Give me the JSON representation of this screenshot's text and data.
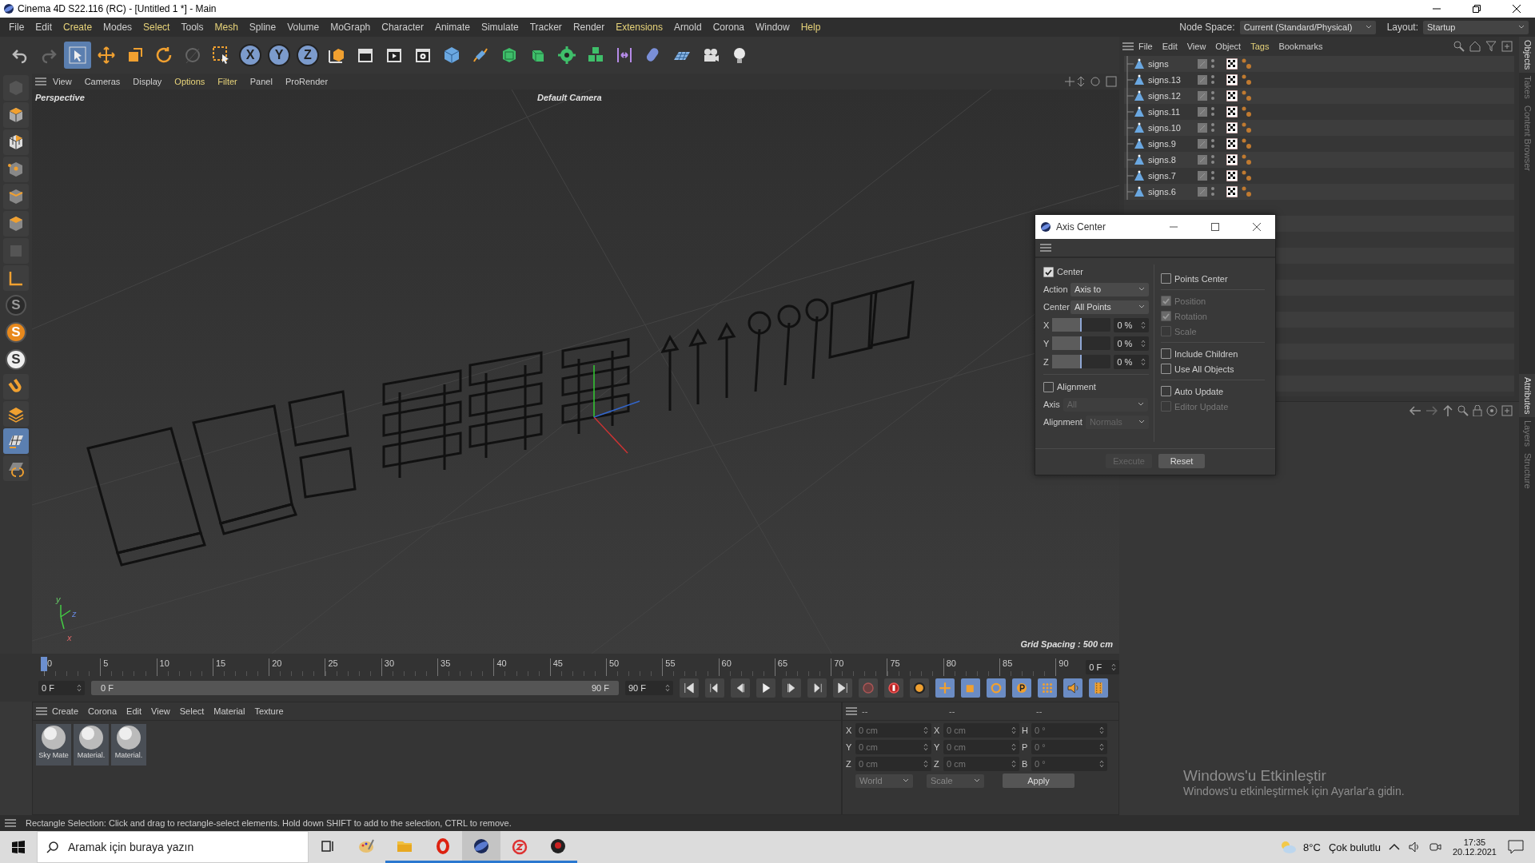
{
  "window": {
    "title": "Cinema 4D S22.116 (RC) - [Untitled 1 *] - Main"
  },
  "menu": [
    {
      "label": "File",
      "highlighted": false
    },
    {
      "label": "Edit",
      "highlighted": false
    },
    {
      "label": "Create",
      "highlighted": true
    },
    {
      "label": "Modes",
      "highlighted": false
    },
    {
      "label": "Select",
      "highlighted": true
    },
    {
      "label": "Tools",
      "highlighted": false
    },
    {
      "label": "Mesh",
      "highlighted": true
    },
    {
      "label": "Spline",
      "highlighted": false
    },
    {
      "label": "Volume",
      "highlighted": false
    },
    {
      "label": "MoGraph",
      "highlighted": false
    },
    {
      "label": "Character",
      "highlighted": false
    },
    {
      "label": "Animate",
      "highlighted": false
    },
    {
      "label": "Simulate",
      "highlighted": false
    },
    {
      "label": "Tracker",
      "highlighted": false
    },
    {
      "label": "Render",
      "highlighted": false
    },
    {
      "label": "Extensions",
      "highlighted": true
    },
    {
      "label": "Arnold",
      "highlighted": false
    },
    {
      "label": "Corona",
      "highlighted": false
    },
    {
      "label": "Window",
      "highlighted": false
    },
    {
      "label": "Help",
      "highlighted": true
    }
  ],
  "node_space": {
    "label": "Node Space:",
    "value": "Current (Standard/Physical)"
  },
  "layout": {
    "label": "Layout:",
    "value": "Startup"
  },
  "toolbar": [
    {
      "kind": "undo",
      "selected": false
    },
    {
      "kind": "redo",
      "selected": false
    },
    {
      "kind": "live-select",
      "selected": true
    },
    {
      "kind": "move",
      "selected": false
    },
    {
      "kind": "scale",
      "selected": false
    },
    {
      "kind": "rotate",
      "selected": false
    },
    {
      "kind": "recent-tools",
      "selected": false
    },
    {
      "kind": "rectangle-select",
      "selected": false
    },
    {
      "kind": "axis",
      "label": "X",
      "selected": true
    },
    {
      "kind": "axis",
      "label": "Y",
      "selected": true
    },
    {
      "kind": "axis",
      "label": "Z",
      "selected": true
    },
    {
      "kind": "coordinate-system",
      "selected": false
    },
    {
      "kind": "render-view",
      "selected": false
    },
    {
      "kind": "render",
      "selected": false
    },
    {
      "kind": "render-settings",
      "selected": false
    },
    {
      "kind": "cube",
      "selected": false
    },
    {
      "kind": "pen",
      "selected": false
    },
    {
      "kind": "subdivision",
      "selected": false
    },
    {
      "kind": "extrude",
      "selected": false
    },
    {
      "kind": "cloner",
      "selected": false
    },
    {
      "kind": "cubes",
      "selected": false
    },
    {
      "kind": "deformer",
      "selected": false
    },
    {
      "kind": "field",
      "selected": false
    },
    {
      "kind": "floor",
      "selected": false
    },
    {
      "kind": "camera",
      "selected": false
    },
    {
      "kind": "light",
      "selected": false
    }
  ],
  "tools": [
    {
      "kind": "make-editable",
      "selected": false
    },
    {
      "kind": "model",
      "selected": false
    },
    {
      "kind": "texture",
      "selected": false
    },
    {
      "kind": "points",
      "selected": false
    },
    {
      "kind": "edges",
      "selected": false
    },
    {
      "kind": "polygons",
      "selected": false
    },
    {
      "kind": "uv",
      "selected": false
    },
    {
      "kind": "axis",
      "selected": false
    },
    {
      "kind": "letter",
      "label": "S",
      "color": "#2b2b2b",
      "selected": false
    },
    {
      "kind": "letter",
      "label": "S",
      "color": "#e8891d",
      "selected": false
    },
    {
      "kind": "letter",
      "label": "S",
      "color": "#eeeeee",
      "selected": false
    },
    {
      "kind": "magnet",
      "selected": false
    },
    {
      "kind": "layers",
      "selected": false
    },
    {
      "kind": "workplane",
      "selected": true
    },
    {
      "kind": "snap",
      "selected": false
    }
  ],
  "viewport": {
    "menu": [
      {
        "label": "View",
        "highlighted": false
      },
      {
        "label": "Cameras",
        "highlighted": false
      },
      {
        "label": "Display",
        "highlighted": false
      },
      {
        "label": "Options",
        "highlighted": true
      },
      {
        "label": "Filter",
        "highlighted": true
      },
      {
        "label": "Panel",
        "highlighted": false
      },
      {
        "label": "ProRender",
        "highlighted": false
      }
    ],
    "view_name": "Perspective",
    "camera": "Default Camera",
    "grid_spacing": "Grid Spacing : 500 cm",
    "axis_labels": [
      "y",
      "z",
      "x"
    ]
  },
  "timeline": {
    "ticks": [
      "0",
      "5",
      "10",
      "15",
      "20",
      "25",
      "30",
      "35",
      "40",
      "45",
      "50",
      "55",
      "60",
      "65",
      "70",
      "75",
      "80",
      "85",
      "90"
    ],
    "current_frame": "0 F",
    "start": "0 F",
    "range": {
      "start": "0 F",
      "end": "90 F",
      "level": 1
    },
    "end": "90 F",
    "keys": [
      {
        "kind": "record",
        "selected": false
      },
      {
        "kind": "auto-key",
        "selected": false
      },
      {
        "kind": "keyframe",
        "selected": false
      },
      {
        "kind": "move",
        "selected": true
      },
      {
        "kind": "scale",
        "selected": true
      },
      {
        "kind": "rotate",
        "selected": true
      },
      {
        "kind": "param",
        "selected": true
      },
      {
        "kind": "points",
        "selected": true
      },
      {
        "kind": "sound",
        "selected": true
      },
      {
        "kind": "film",
        "selected": true
      }
    ]
  },
  "materials": {
    "menu": [
      "Create",
      "Corona",
      "Edit",
      "View",
      "Select",
      "Material",
      "Texture"
    ],
    "items": [
      "Sky Mate",
      "Material.",
      "Material."
    ]
  },
  "coordinates": {
    "headers": [
      "--",
      "--",
      "--"
    ],
    "rows": [
      {
        "axes": [
          "X",
          "X",
          "H"
        ],
        "values": [
          "0 cm",
          "0 cm",
          "0 °"
        ]
      },
      {
        "axes": [
          "Y",
          "Y",
          "P"
        ],
        "values": [
          "0 cm",
          "0 cm",
          "0 °"
        ]
      },
      {
        "axes": [
          "Z",
          "Z",
          "B"
        ],
        "values": [
          "0 cm",
          "0 cm",
          "0 °"
        ]
      }
    ],
    "mode": "World",
    "transform": "Scale",
    "apply": "Apply"
  },
  "objects": {
    "menu": [
      {
        "label": "File",
        "highlighted": false
      },
      {
        "label": "Edit",
        "highlighted": false
      },
      {
        "label": "View",
        "highlighted": false
      },
      {
        "label": "Object",
        "highlighted": false
      },
      {
        "label": "Tags",
        "highlighted": true
      },
      {
        "label": "Bookmarks",
        "highlighted": false
      }
    ],
    "items": [
      "signs",
      "signs.13",
      "signs.12",
      "signs.11",
      "signs.10",
      "signs.9",
      "signs.8",
      "signs.7",
      "signs.6"
    ]
  },
  "side_tabs_top": [
    {
      "label": "Objects",
      "selected": true
    },
    {
      "label": "Takes",
      "selected": false
    },
    {
      "label": "Content Browser",
      "selected": false
    }
  ],
  "side_tabs_bottom": [
    {
      "label": "Attributes",
      "selected": true
    },
    {
      "label": "Layers",
      "selected": false
    },
    {
      "label": "Structure",
      "selected": false
    }
  ],
  "dialog": {
    "title": "Axis Center",
    "center": {
      "label": "Center",
      "checked": true
    },
    "dropdowns": [
      {
        "label": "Action",
        "value": "Axis to",
        "disabled": false
      },
      {
        "label": "Center",
        "value": "All Points",
        "disabled": false
      }
    ],
    "sliders": [
      {
        "axis": "X",
        "level": 0.5,
        "value": "0 %"
      },
      {
        "axis": "Y",
        "level": 0.5,
        "value": "0 %"
      },
      {
        "axis": "Z",
        "level": 0.5,
        "value": "0 %"
      }
    ],
    "alignment": {
      "label": "Alignment",
      "checked": false
    },
    "align_dropdowns": [
      {
        "label": "Axis",
        "value": "All",
        "disabled": true
      },
      {
        "label": "Alignment",
        "value": "Normals",
        "disabled": true
      }
    ],
    "groups": [
      [
        {
          "label": "Points Center",
          "checked": false,
          "disabled": false
        }
      ],
      [
        {
          "label": "Position",
          "checked": true,
          "disabled": true
        },
        {
          "label": "Rotation",
          "checked": true,
          "disabled": true
        },
        {
          "label": "Scale",
          "checked": false,
          "disabled": true
        }
      ],
      [
        {
          "label": "Include Children",
          "checked": false,
          "disabled": false
        },
        {
          "label": "Use All Objects",
          "checked": false,
          "disabled": false
        }
      ],
      [
        {
          "label": "Auto Update",
          "checked": false,
          "disabled": false
        },
        {
          "label": "Editor Update",
          "checked": false,
          "disabled": true
        }
      ]
    ],
    "buttons": [
      {
        "label": "Execute",
        "disabled": true
      },
      {
        "label": "Reset",
        "disabled": false
      }
    ]
  },
  "status_bar": "Rectangle Selection: Click and drag to rectangle-select elements. Hold down SHIFT to add to the selection, CTRL to remove.",
  "activation": {
    "title": "Windows'u Etkinleştir",
    "text": "Windows'u etkinleştirmek için Ayarlar'a gidin."
  },
  "taskbar": {
    "search_placeholder": "Aramak için buraya yazın",
    "apps": [
      {
        "kind": "task-view",
        "open": false,
        "selected": false
      },
      {
        "kind": "paint",
        "open": false,
        "selected": false
      },
      {
        "kind": "folder",
        "open": true,
        "selected": false
      },
      {
        "kind": "red-o",
        "open": true,
        "selected": false
      },
      {
        "kind": "sphere",
        "open": true,
        "selected": true
      },
      {
        "kind": "red-s",
        "open": true,
        "selected": false
      },
      {
        "kind": "dark",
        "open": true,
        "selected": false
      }
    ],
    "weather": {
      "temp": "8°C",
      "text": "Çok bulutlu"
    },
    "time": "17:35",
    "date": "20.12.2021"
  }
}
